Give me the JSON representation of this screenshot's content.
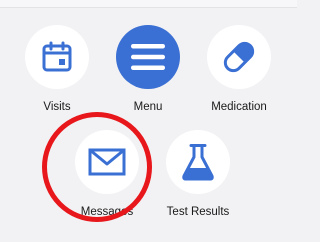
{
  "grid": {
    "row1": [
      {
        "id": "visits",
        "label": "Visits",
        "icon": "calendar-icon"
      },
      {
        "id": "menu",
        "label": "Menu",
        "icon": "hamburger-menu-icon"
      },
      {
        "id": "medication",
        "label": "Medication",
        "icon": "pill-icon"
      }
    ],
    "row2": [
      {
        "id": "messages",
        "label": "Messages",
        "icon": "envelope-icon"
      },
      {
        "id": "test_results",
        "label": "Test Results",
        "icon": "flask-icon"
      }
    ]
  },
  "colors": {
    "accent": "#3a6fd3",
    "highlight": "#e8171b",
    "background": "#f2f2f4"
  }
}
